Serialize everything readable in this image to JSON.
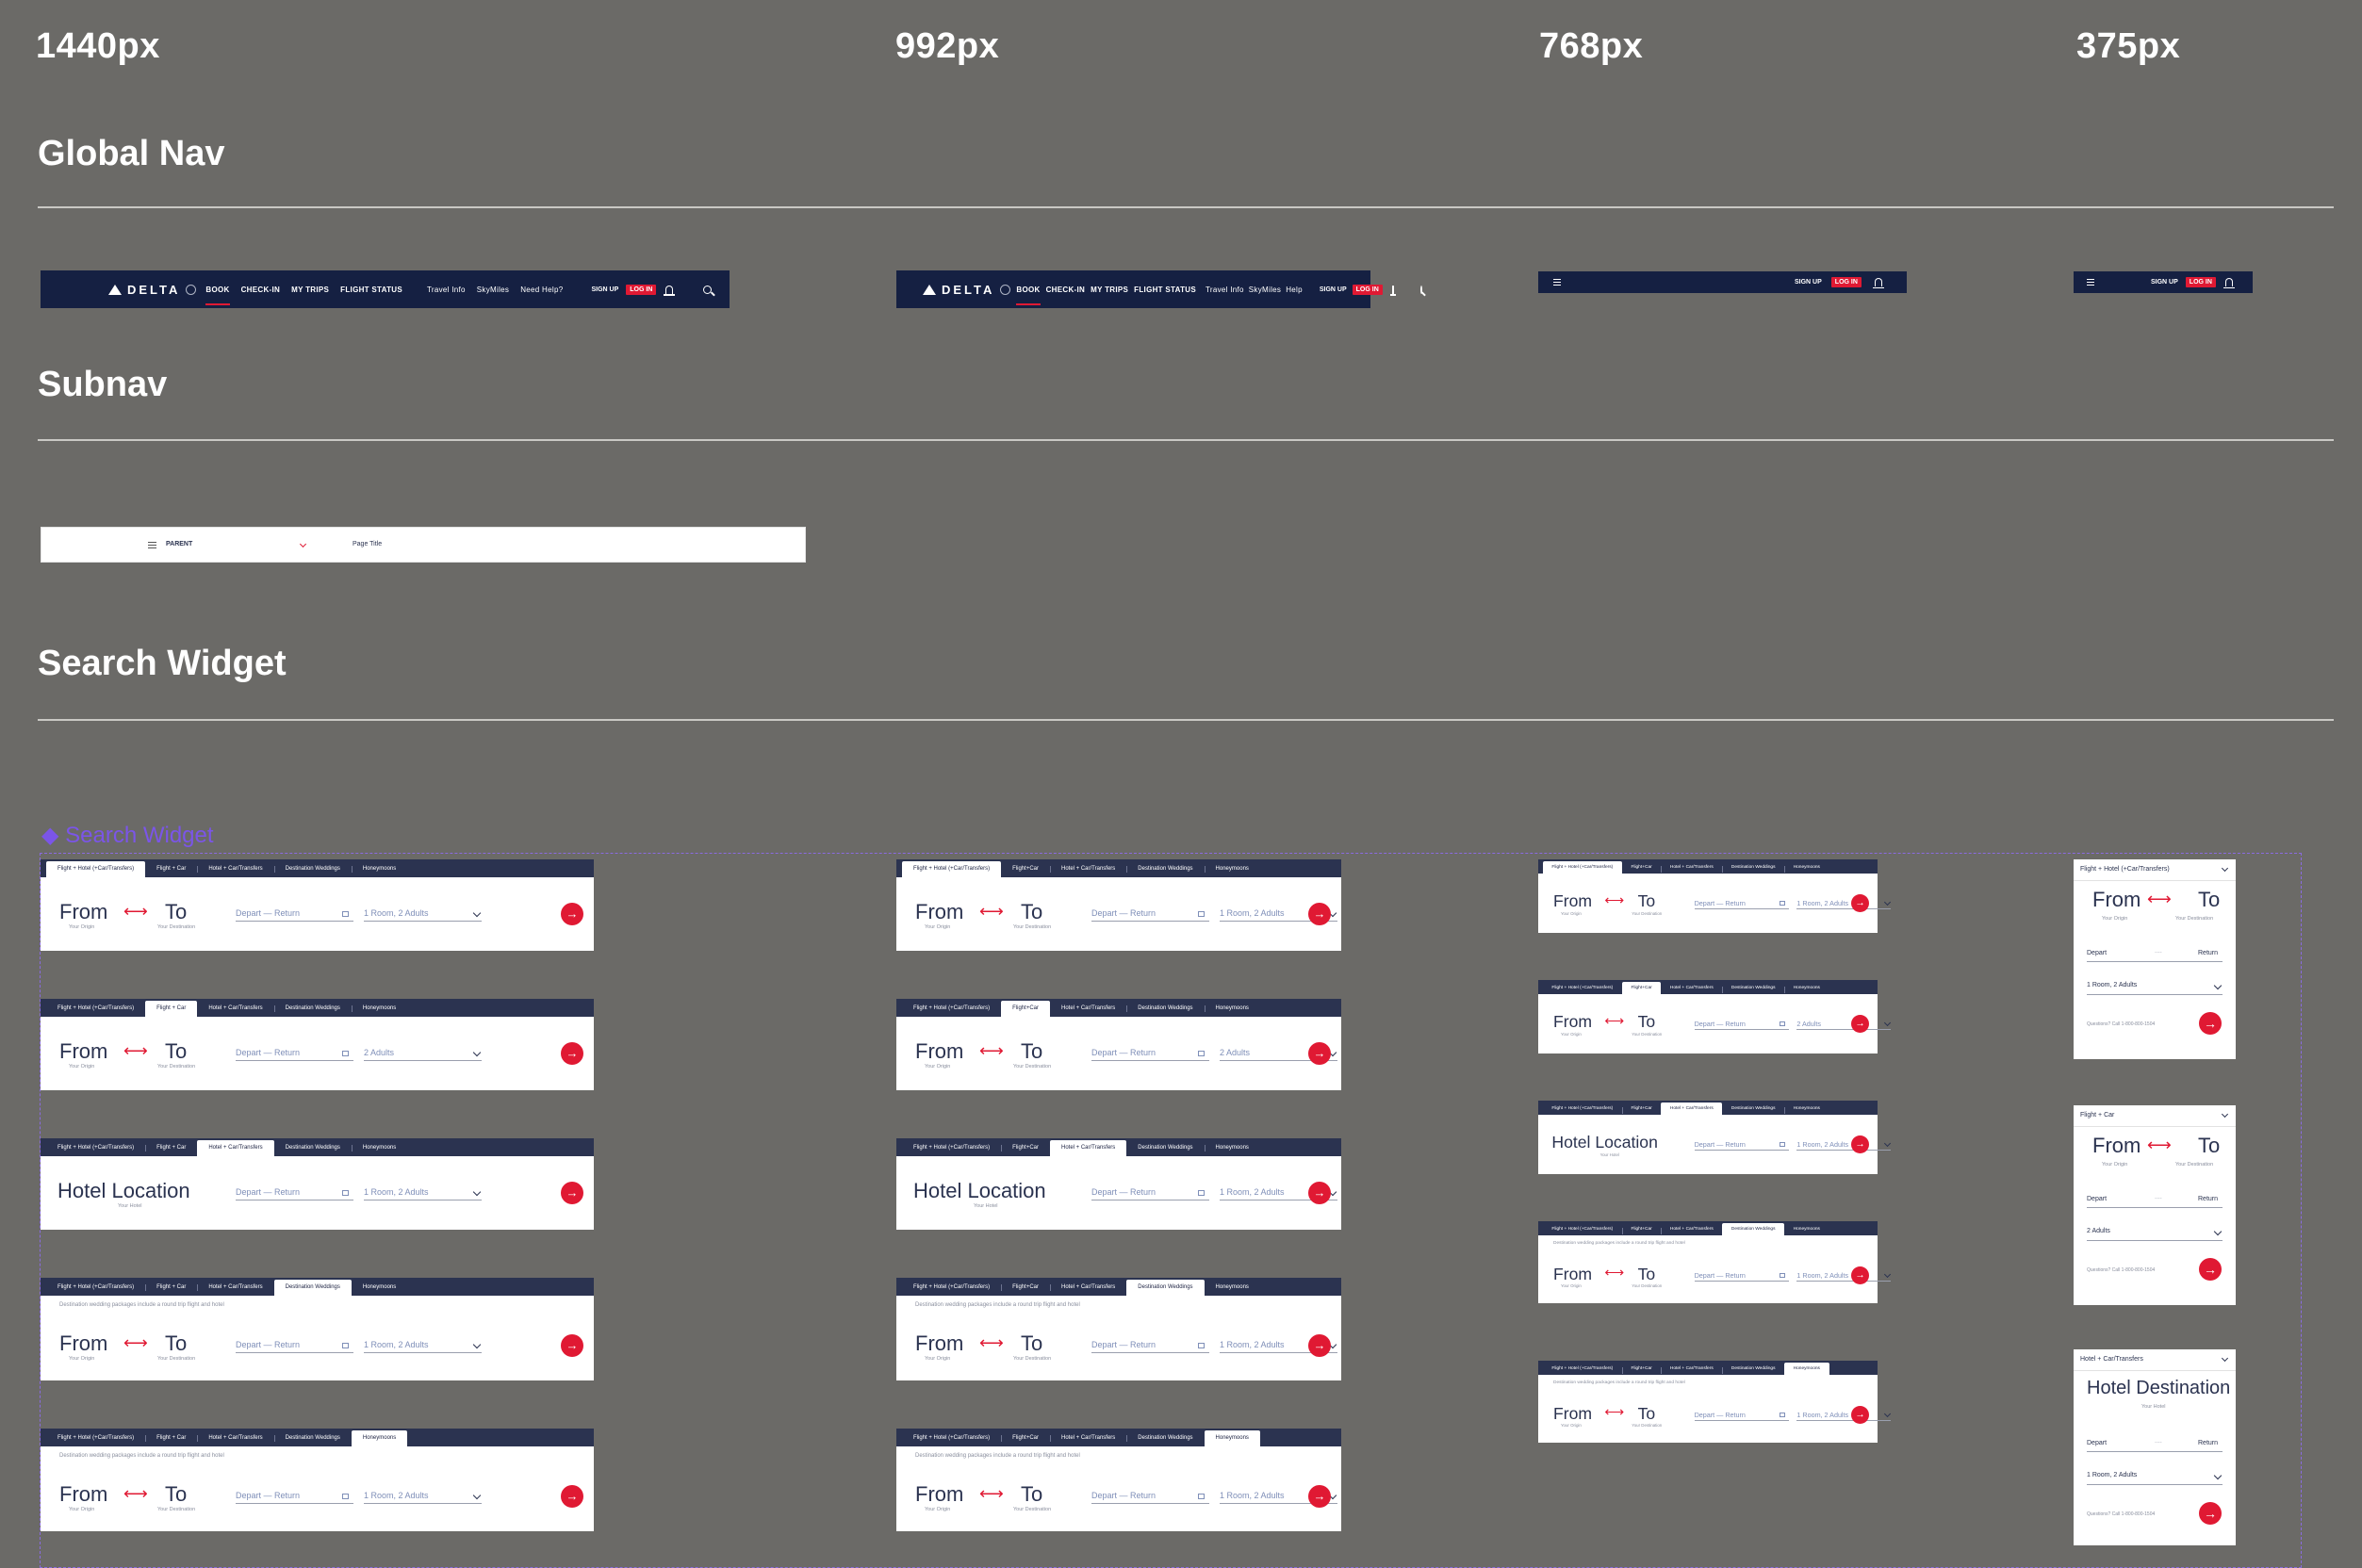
{
  "breakpoints": [
    "1440px",
    "992px",
    "768px",
    "375px"
  ],
  "sections": {
    "global_nav": "Global Nav",
    "subnav": "Subnav",
    "search_widget": "Search Widget"
  },
  "nav": {
    "logo": "DELTA",
    "items": [
      "BOOK",
      "CHECK-IN",
      "MY TRIPS",
      "FLIGHT STATUS"
    ],
    "secondary": [
      "Travel Info",
      "SkyMiles",
      "Need Help?"
    ],
    "secondary_short": [
      "Travel Info",
      "SkyMiles",
      "Help"
    ],
    "signup": "SIGN UP",
    "login": "LOG IN"
  },
  "subnav": {
    "parent": "PARENT",
    "page_title": "Page Title"
  },
  "selection_label": "Search Widget",
  "widget": {
    "tabs": [
      "Flight + Hotel (+Car/Transfers)",
      "Flight + Car",
      "Hotel + Car/Transfers",
      "Destination Weddings",
      "Honeymoons"
    ],
    "tabs_compact": [
      "Flight + Hotel (+Car/Transfers)",
      "Flight+Car",
      "Hotel + Car/Transfers",
      "Destination Weddings",
      "Honeymoons"
    ],
    "from": "From",
    "from_sub": "Your Origin",
    "to": "To",
    "to_sub": "Your Destination",
    "swap": "⟷",
    "date": "Depart — Return",
    "pax_room": "1 Room, 2 Adults",
    "pax_adults": "2 Adults",
    "hotel": "Hotel Location",
    "hotel_sub": "Your Hotel",
    "promo": "Destination wedding packages include a round trip flight and hotel",
    "go": "→"
  },
  "mobile": {
    "heads": [
      "Flight + Hotel (+Car/Transfers)",
      "Flight + Car",
      "Hotel + Car/Transfers"
    ],
    "hotel_destination": "Hotel Destination",
    "depart": "Depart",
    "dots": "....",
    "return": "Return",
    "questions": "Questions? Call 1-800-800-1504"
  },
  "colors": {
    "background": "#6b6a67",
    "navy": "#152042",
    "tab_bar": "#2b3350",
    "red": "#e01933",
    "selection": "#7b55e8"
  }
}
